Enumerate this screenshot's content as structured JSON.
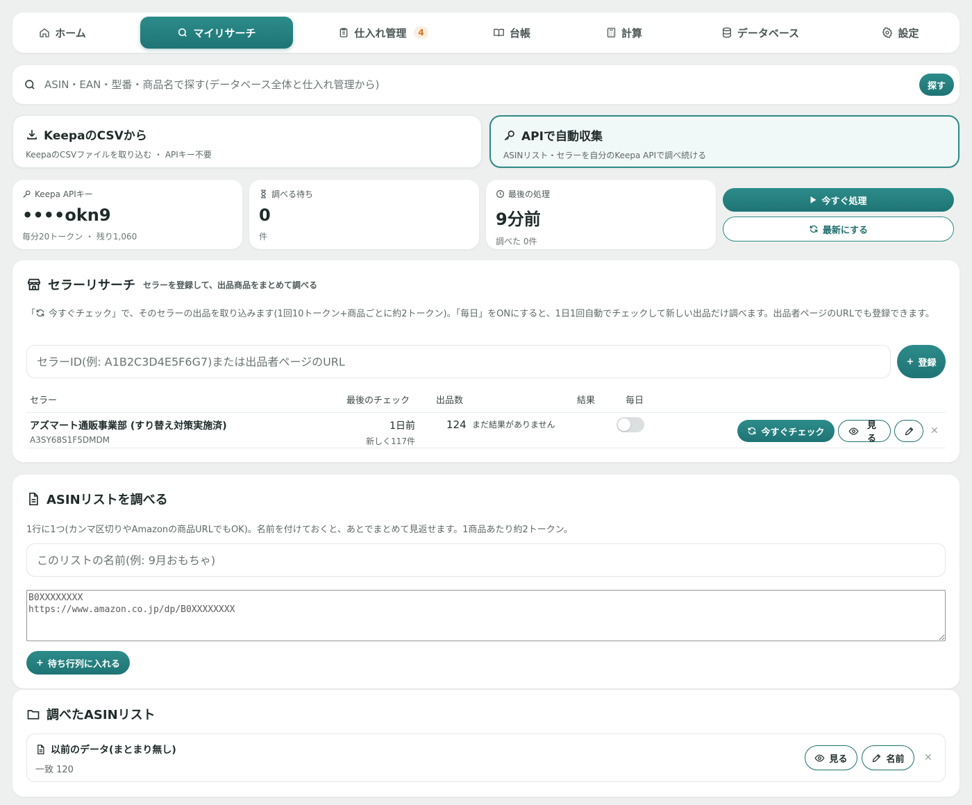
{
  "nav": {
    "items": [
      {
        "label": "ホーム",
        "icon": "home-icon"
      },
      {
        "label": "マイリサーチ",
        "icon": "search-icon",
        "active": true
      },
      {
        "label": "仕入れ管理",
        "icon": "clipboard-icon",
        "badge": "4"
      },
      {
        "label": "台帳",
        "icon": "book-icon"
      },
      {
        "label": "計算",
        "icon": "calculator-icon"
      },
      {
        "label": "データベース",
        "icon": "database-icon"
      },
      {
        "label": "設定",
        "icon": "gear-icon"
      }
    ]
  },
  "search": {
    "placeholder": "ASIN・EAN・型番・商品名で探す(データベース全体と仕入れ管理から)",
    "button": "探す"
  },
  "sources": {
    "csv": {
      "title": "KeepaのCSVから",
      "sub": "KeepaのCSVファイルを取り込む ・ APIキー不要"
    },
    "api": {
      "title": "APIで自動収集",
      "sub": "ASINリスト・セラーを自分のKeepa APIで調べ続ける",
      "selected": true
    }
  },
  "stats": {
    "key": {
      "label": "Keepa APIキー",
      "value": "••••okn9",
      "sub": "毎分20トークン ・ 残り1,060"
    },
    "wait": {
      "label": "調べる待ち",
      "value": "0",
      "sub": "件"
    },
    "last": {
      "label": "最後の処理",
      "value": "9分前",
      "sub": "調べた 0件"
    }
  },
  "actions": {
    "process": "今すぐ処理",
    "refresh": "最新にする"
  },
  "seller": {
    "title": "セラーリサーチ",
    "subtitle": "セラーを登録して、出品商品をまとめて調べる",
    "desc_before": "「",
    "desc_after": "今すぐチェック」で、そのセラーの出品を取り込みます(1回10トークン+商品ごとに約2トークン)。「毎日」をONにすると、1日1回自動でチェックして新しい出品だけ調べます。出品者ページのURLでも登録できます。",
    "input_placeholder": "セラーID(例: A1B2C3D4E5F6G7)または出品者ページのURL",
    "register": "登録",
    "columns": {
      "seller": "セラー",
      "last_check": "最後のチェック",
      "count": "出品数",
      "result": "結果",
      "daily": "毎日"
    },
    "rows": [
      {
        "name": "アズマート通販事業部 (すり替え対策実施済)",
        "id": "A3SY68S1F5DMDM",
        "last_check": "1日前",
        "new_count": "新しく117件",
        "count": "124",
        "result": "まだ結果がありません",
        "daily": false,
        "check_btn": "今すぐチェック",
        "view_btn": "見る"
      }
    ]
  },
  "asin": {
    "title": "ASINリストを調べる",
    "desc": "1行に1つ(カンマ区切りやAmazonの商品URLでもOK)。名前を付けておくと、あとでまとめて見返せます。1商品あたり約2トークン。",
    "name_placeholder": "このリストの名前(例: 9月おもちゃ)",
    "text_placeholder": "B0XXXXXXXX\nhttps://www.amazon.co.jp/dp/B0XXXXXXXX",
    "queue_btn": "待ち行列に入れる"
  },
  "saved": {
    "title": "調べたASINリスト",
    "lists": [
      {
        "name": "以前のデータ(まとまり無し)",
        "sub": "一致 120",
        "view": "見る",
        "rename": "名前"
      }
    ]
  },
  "colors": {
    "accent": "#1f7474",
    "accent_light": "#2c8c8a",
    "badge": "#d9731e"
  }
}
